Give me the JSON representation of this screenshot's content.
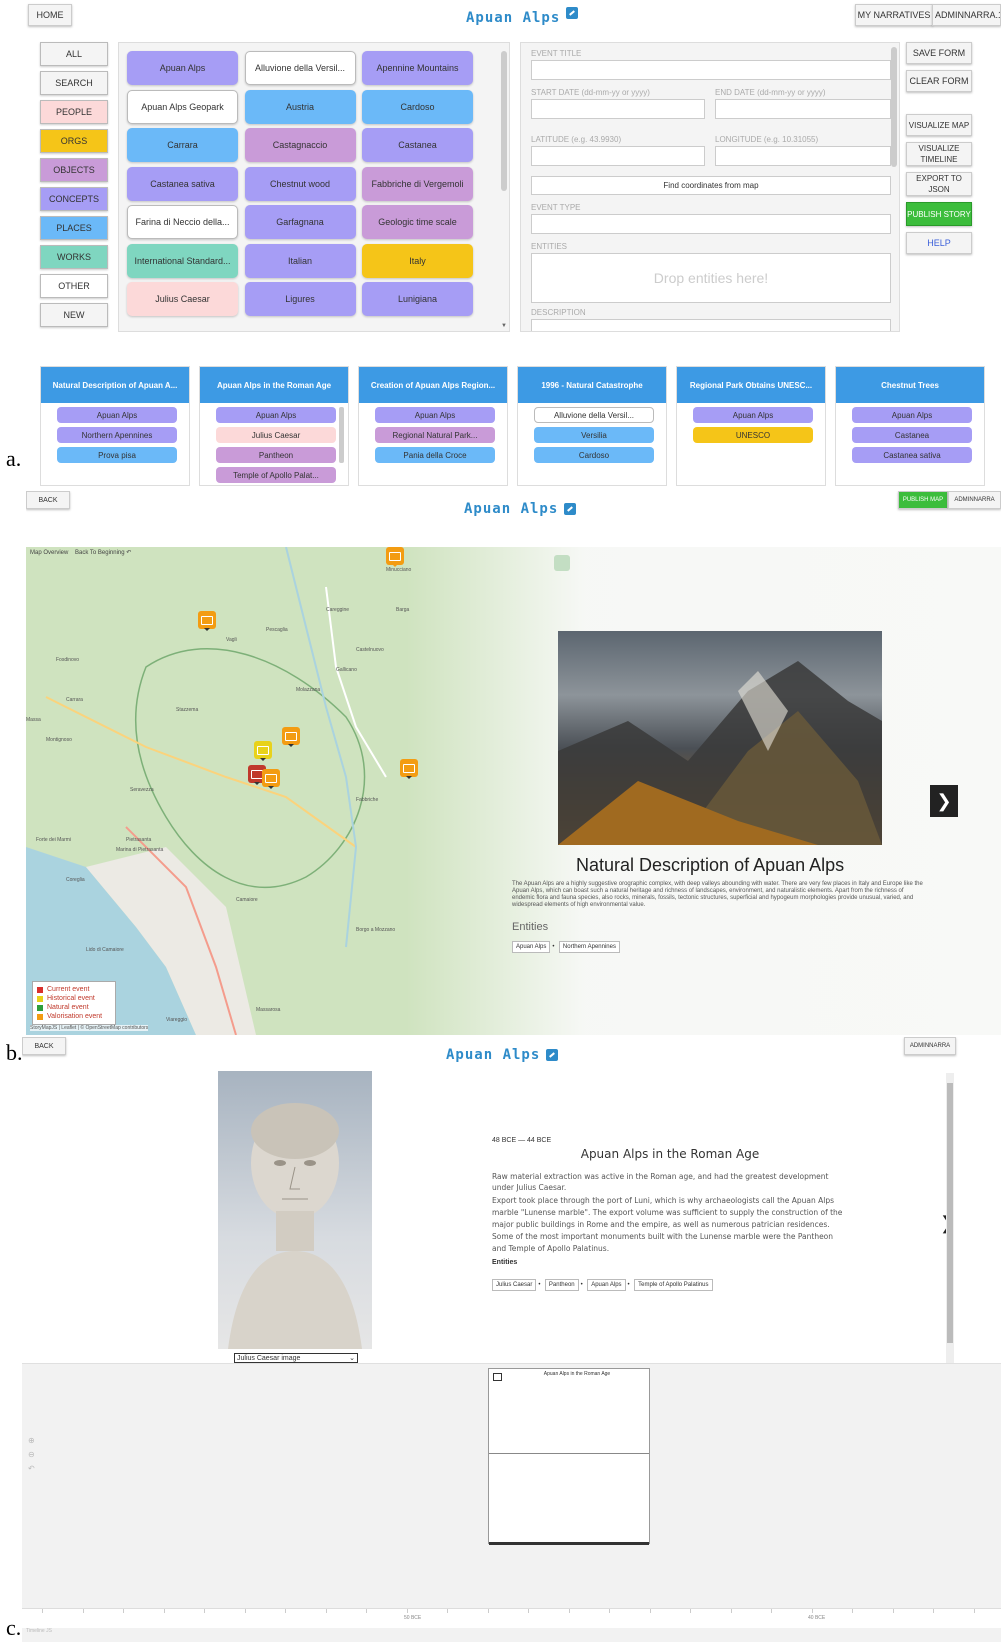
{
  "labels": {
    "a": "a.",
    "b": "b.",
    "c": "c."
  },
  "brand": "Apuan Alps",
  "panel_a": {
    "home": "HOME",
    "my_narratives": "MY NARRATIVES",
    "user": "ADMINNARRA.1",
    "filters": [
      "ALL",
      "SEARCH",
      "PEOPLE",
      "ORGS",
      "OBJECTS",
      "CONCEPTS",
      "PLACES",
      "WORKS",
      "OTHER",
      "NEW"
    ],
    "filter_colors": [
      "#f4f4f4",
      "#f4f4f4",
      "#fcd9d9",
      "#f5c518",
      "#c99bd8",
      "#a69df5",
      "#6bb9f8",
      "#7fd6c0",
      "#ffffff",
      "#f4f4f4"
    ],
    "entities": [
      {
        "label": "Apuan Alps",
        "color": "#a69df5"
      },
      {
        "label": "Alluvione della Versil...",
        "color": "#ffffff"
      },
      {
        "label": "Apennine Mountains",
        "color": "#a69df5"
      },
      {
        "label": "Apuan Alps Geopark",
        "color": "#ffffff"
      },
      {
        "label": "Austria",
        "color": "#6bb9f8"
      },
      {
        "label": "Cardoso",
        "color": "#6bb9f8"
      },
      {
        "label": "Carrara",
        "color": "#6bb9f8"
      },
      {
        "label": "Castagnaccio",
        "color": "#c99bd8"
      },
      {
        "label": "Castanea",
        "color": "#a69df5"
      },
      {
        "label": "Castanea sativa",
        "color": "#a69df5"
      },
      {
        "label": "Chestnut wood",
        "color": "#a69df5"
      },
      {
        "label": "Fabbriche di Vergemoli",
        "color": "#c99bd8"
      },
      {
        "label": "Farina di Neccio della...",
        "color": "#ffffff"
      },
      {
        "label": "Garfagnana",
        "color": "#a69df5"
      },
      {
        "label": "Geologic time scale",
        "color": "#c99bd8"
      },
      {
        "label": "International Standard...",
        "color": "#7fd6c0"
      },
      {
        "label": "Italian",
        "color": "#a69df5"
      },
      {
        "label": "Italy",
        "color": "#f5c518"
      },
      {
        "label": "Julius Caesar",
        "color": "#fcd9d9"
      },
      {
        "label": "Ligures",
        "color": "#a69df5"
      },
      {
        "label": "Lunigiana",
        "color": "#a69df5"
      }
    ],
    "form": {
      "event_title": "EVENT TITLE",
      "start_date": "START DATE (dd-mm-yy or yyyy)",
      "end_date": "END DATE (dd-mm-yy or yyyy)",
      "latitude": "LATITUDE (e.g. 43.9930)",
      "longitude": "LONGITUDE (e.g. 10.31055)",
      "find_coords": "Find coordinates from map",
      "event_type": "EVENT TYPE",
      "entities": "ENTITIES",
      "drop": "Drop entities here!",
      "description": "DESCRIPTION"
    },
    "actions": [
      "SAVE FORM",
      "CLEAR FORM",
      "VISUALIZE MAP",
      "VISUALIZE TIMELINE",
      "EXPORT TO JSON",
      "PUBLISH STORY",
      "HELP"
    ],
    "cards": [
      {
        "title": "Natural Description of Apuan A...",
        "chips": [
          {
            "label": "Apuan Alps",
            "color": "#a69df5"
          },
          {
            "label": "Northern Apennines",
            "color": "#a69df5"
          },
          {
            "label": "Prova pisa",
            "color": "#6bb9f8"
          }
        ]
      },
      {
        "title": "Apuan Alps in the Roman Age",
        "chips": [
          {
            "label": "Apuan Alps",
            "color": "#a69df5"
          },
          {
            "label": "Julius Caesar",
            "color": "#fcd9d9"
          },
          {
            "label": "Pantheon",
            "color": "#c99bd8"
          },
          {
            "label": "Temple of Apollo Palat...",
            "color": "#c99bd8"
          }
        ]
      },
      {
        "title": "Creation of Apuan Alps Region...",
        "chips": [
          {
            "label": "Apuan Alps",
            "color": "#a69df5"
          },
          {
            "label": "Regional Natural Park...",
            "color": "#c99bd8"
          },
          {
            "label": "Pania della Croce",
            "color": "#6bb9f8"
          }
        ]
      },
      {
        "title": "1996 - Natural Catastrophe",
        "chips": [
          {
            "label": "Alluvione della Versil...",
            "color": "#ffffff"
          },
          {
            "label": "Versilia",
            "color": "#6bb9f8"
          },
          {
            "label": "Cardoso",
            "color": "#6bb9f8"
          }
        ]
      },
      {
        "title": "Regional Park Obtains UNESC...",
        "chips": [
          {
            "label": "Apuan Alps",
            "color": "#a69df5"
          },
          {
            "label": "UNESCO",
            "color": "#f5c518"
          }
        ]
      },
      {
        "title": "Chestnut Trees",
        "chips": [
          {
            "label": "Apuan Alps",
            "color": "#a69df5"
          },
          {
            "label": "Castanea",
            "color": "#a69df5"
          },
          {
            "label": "Castanea sativa",
            "color": "#a69df5"
          }
        ]
      }
    ]
  },
  "panel_b": {
    "back": "BACK",
    "publish_map": "PUBLISH MAP",
    "user": "ADMINNARRA",
    "map_overview": "Map Overview",
    "back_to_beginning": "Back To Beginning",
    "title": "Natural Description of Apuan Alps",
    "description": "The Apuan Alps are a highly suggestive orographic complex, with deep valleys abounding with water. There are very few places in Italy and Europe like the Apuan Alps, which can boast such a natural heritage and richness of landscapes, environment, and naturalistic elements. Apart from the richness of endemic flora and fauna species, also rocks, minerals, fossils, tectonic structures, superficial and hypogeum morphologies provide unusual, varied, and widespread elements of high environmental value.",
    "entities_heading": "Entities",
    "entities": [
      "Apuan Alps",
      "Northern Apennines"
    ],
    "legend": [
      {
        "label": "Current event",
        "color": "#d9302c"
      },
      {
        "label": "Historical event",
        "color": "#e8d21a"
      },
      {
        "label": "Natural event",
        "color": "#2e9e3a"
      },
      {
        "label": "Valorisation event",
        "color": "#f39c12"
      }
    ],
    "attribution": "StoryMapJS | Leaflet | © OpenStreetMap contributors",
    "places": [
      "Massa",
      "Montignoso",
      "Seravezza",
      "Pietrasanta",
      "Camaiore",
      "Viareggio",
      "Massarosa",
      "Castelnuovo",
      "Gallicano",
      "Barga",
      "Pescaglia",
      "Fosdinovo",
      "Carrara",
      "Stazzema",
      "Vagli",
      "Minucciano",
      "Careggine",
      "Molazzana",
      "Fabbriche",
      "Borgo a Mozzano",
      "Coreglia",
      "Lido di Camaiore",
      "Forte dei Marmi",
      "Marina di Pietrasanta"
    ]
  },
  "panel_c": {
    "back": "BACK",
    "user": "ADMINNARRA",
    "date": "48 BCE — 44 BCE",
    "title": "Apuan Alps in the Roman Age",
    "p1": "Raw material extraction was active in the Roman age, and had the greatest development under Julius Caesar.",
    "p2": "Export took place through the port of Luni, which is why archaeologists call the Apuan Alps marble \"Lunense marble\". The export volume was sufficient to supply the construction of the major public buildings in Rome and the empire, as well as numerous patrician residences. Some of the most important monuments built with the Lunense marble were the Pantheon and Temple of Apollo Palatinus.",
    "entities_heading": "Entities",
    "entities": [
      "Julius Caesar",
      "Pantheon",
      "Apuan Alps",
      "Temple of Apollo Palatinus"
    ],
    "image_select": "Julius Caesar image",
    "timeline_card": "Apuan Alps in the Roman Age",
    "timeline_credit": "Timeline JS",
    "axis_labels": [
      "50 BCE",
      "40 BCE"
    ]
  }
}
